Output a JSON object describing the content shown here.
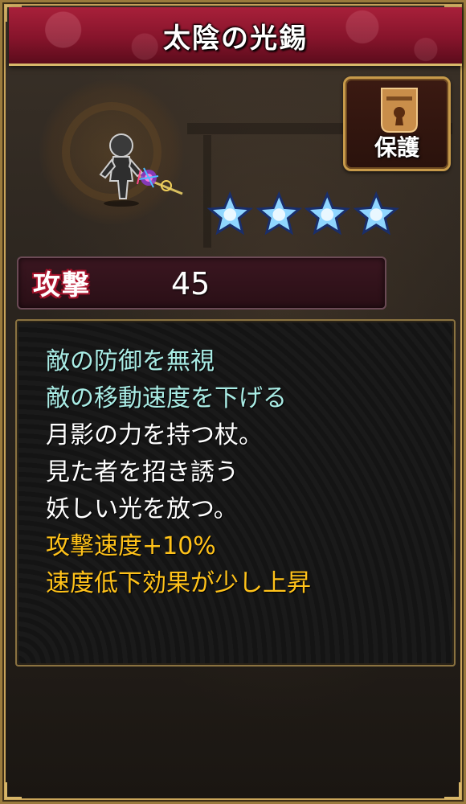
{
  "item": {
    "name": "太陰の光錫",
    "rarity_stars": 4,
    "star_color": "#8fd6ff"
  },
  "protect_button": {
    "label": "保護",
    "icon": "lock-icon"
  },
  "stat": {
    "label": "攻撃",
    "value": "45"
  },
  "description": {
    "effects": [
      "敵の防御を無視",
      "敵の移動速度を下げる"
    ],
    "flavor": [
      "月影の力を持つ杖。",
      "見た者を招き誘う",
      "妖しい光を放つ。"
    ],
    "bonuses": [
      "攻撃速度+10%",
      "速度低下効果が少し上昇"
    ]
  },
  "colors": {
    "title_bar": "#86142b",
    "frame_gold": "#c9a45a",
    "effect_text": "#a9ece5",
    "flavor_text": "#ffffff",
    "bonus_text": "#ffc21a"
  }
}
